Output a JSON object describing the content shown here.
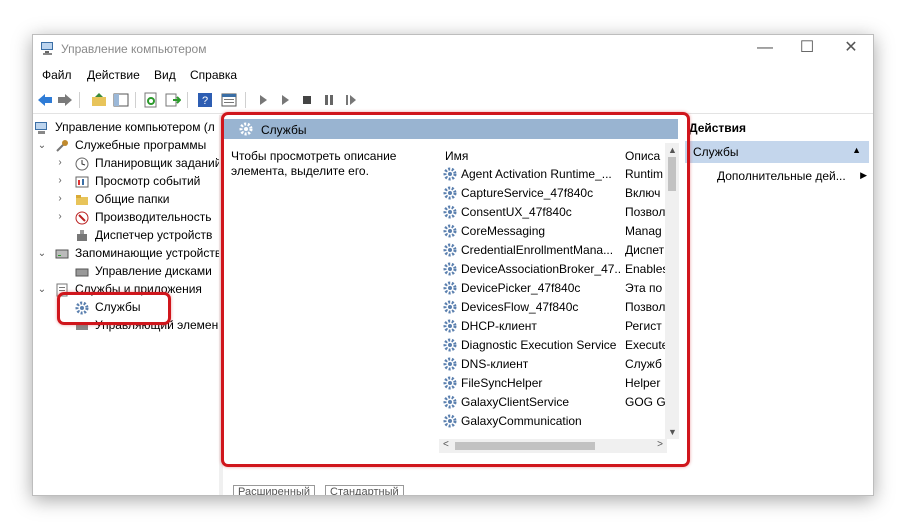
{
  "window": {
    "title": "Управление компьютером",
    "minimize": "—",
    "maximize": "☐",
    "close": "✕"
  },
  "menu": [
    "Файл",
    "Действие",
    "Вид",
    "Справка"
  ],
  "toolbar_icons": [
    "back-icon",
    "forward-icon",
    "up-folder-icon",
    "show-tree-icon",
    "refresh-icon",
    "export-icon",
    "help-icon",
    "properties-icon",
    "play-icon",
    "play-alt-icon",
    "stop-icon",
    "pause-icon",
    "restart-icon"
  ],
  "tree": {
    "root": "Управление компьютером (л",
    "items": [
      {
        "label": "Служебные программы",
        "level": 1,
        "expanded": true,
        "icon": "tools-icon"
      },
      {
        "label": "Планировщик заданий",
        "level": 2,
        "expanded": false,
        "icon": "clock-icon"
      },
      {
        "label": "Просмотр событий",
        "level": 2,
        "expanded": false,
        "icon": "event-viewer-icon"
      },
      {
        "label": "Общие папки",
        "level": 2,
        "expanded": false,
        "icon": "shared-folder-icon"
      },
      {
        "label": "Производительность",
        "level": 2,
        "expanded": false,
        "icon": "performance-icon"
      },
      {
        "label": "Диспетчер устройств",
        "level": 2,
        "icon": "device-manager-icon"
      },
      {
        "label": "Запоминающие устройств",
        "level": 1,
        "expanded": true,
        "icon": "storage-icon"
      },
      {
        "label": "Управление дисками",
        "level": 2,
        "icon": "disk-icon"
      },
      {
        "label": "Службы и приложения",
        "level": 1,
        "expanded": true,
        "icon": "services-apps-icon"
      },
      {
        "label": "Службы",
        "level": 2,
        "icon": "gear-icon",
        "selected": true
      },
      {
        "label": "Управляющий элемен",
        "level": 2,
        "icon": "wmi-icon"
      }
    ]
  },
  "center": {
    "header_title": "Службы",
    "description": "Чтобы просмотреть описание элемента, выделите его.",
    "columns": {
      "name": "Имя",
      "description": "Описа"
    },
    "services": [
      {
        "name": "Agent Activation Runtime_...",
        "desc": "Runtim"
      },
      {
        "name": "CaptureService_47f840c",
        "desc": "Включ"
      },
      {
        "name": "ConsentUX_47f840c",
        "desc": "Позвол"
      },
      {
        "name": "CoreMessaging",
        "desc": "Manag"
      },
      {
        "name": "CredentialEnrollmentMana...",
        "desc": "Диспет"
      },
      {
        "name": "DeviceAssociationBroker_47...",
        "desc": "Enables"
      },
      {
        "name": "DevicePicker_47f840c",
        "desc": "Эта по"
      },
      {
        "name": "DevicesFlow_47f840c",
        "desc": "Позвол"
      },
      {
        "name": "DHCP-клиент",
        "desc": "Регист"
      },
      {
        "name": "Diagnostic Execution Service",
        "desc": "Execute"
      },
      {
        "name": "DNS-клиент",
        "desc": "Служб"
      },
      {
        "name": "FileSyncHelper",
        "desc": "Helper"
      },
      {
        "name": "GalaxyClientService",
        "desc": "GOG G"
      },
      {
        "name": "GalaxyCommunication",
        "desc": ""
      }
    ],
    "tabs": [
      "Расширенный",
      "Стандартный"
    ]
  },
  "actions": {
    "header": "Действия",
    "selected": "Службы",
    "more": "Дополнительные дей..."
  },
  "colors": {
    "header_bg": "#99b4d1",
    "selection_bg": "#c4d6ec",
    "highlight_red": "#d0161c"
  }
}
